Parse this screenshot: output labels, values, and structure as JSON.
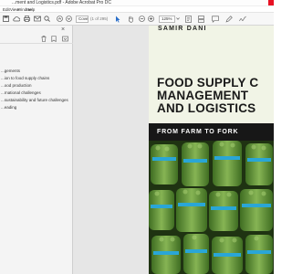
{
  "window": {
    "title": "...ment and Logistics.pdf - Adobe Acrobat Pro DC"
  },
  "menu": {
    "items": [
      "Edit",
      "View",
      "Window",
      "Help"
    ]
  },
  "toolbar": {
    "page_label": "Cover",
    "page_count": "(1 of 295)",
    "zoom_value": "125%"
  },
  "sidebar": {
    "bookmarks": [
      "...gements",
      "...ion to food supply chains",
      "...ood production",
      "...rnational challenges",
      "...sustainability and future challenges",
      "...eading"
    ]
  },
  "book": {
    "author": "SAMIR DANI",
    "title_lines": [
      "FOOD SUPPLY C",
      "MANAGEMENT",
      "AND LOGISTICS"
    ],
    "subtitle": "FROM FARM TO FORK"
  },
  "colors": {
    "cover_background": "#f1f4e6",
    "subtitle_band": "#171717",
    "asparagus_green": "#5e8f3a",
    "band_blue": "#2aa6d6"
  }
}
